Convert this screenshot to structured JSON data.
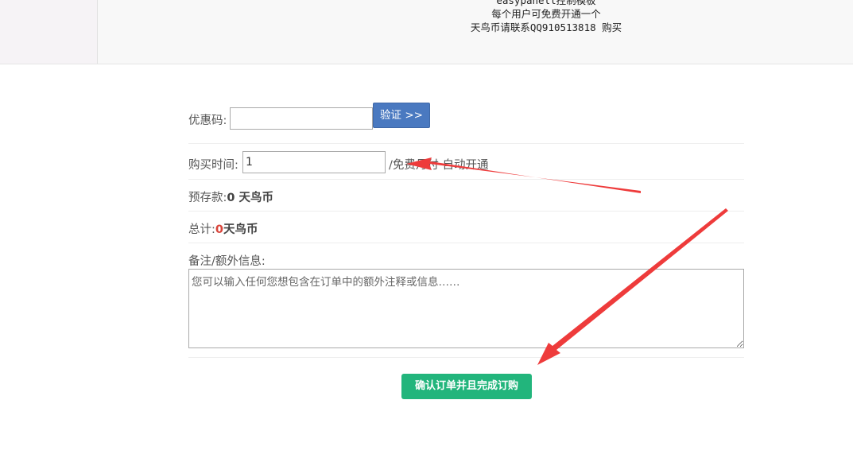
{
  "product": {
    "lines": [
      "easypanell控制模板",
      "每个用户可免费开通一个",
      "天鸟币请联系QQ910513818 购买"
    ]
  },
  "form": {
    "promo": {
      "label": "优惠码:",
      "value": "",
      "verify_label": "验证 >>"
    },
    "purchase_time": {
      "label": "购买时间:",
      "value": "1",
      "suffix": "/免费月付 自动开通"
    },
    "balance": {
      "label": "预存款:",
      "value": "0 天鸟币"
    },
    "total": {
      "label": "总计:",
      "amount": "0",
      "unit": "天鸟币"
    },
    "notes": {
      "label": "备注/额外信息:",
      "placeholder": "您可以输入任何您想包含在订单中的额外注释或信息……"
    },
    "confirm_label": "确认订单并且完成订购"
  },
  "colors": {
    "verify_button": "#4a79c0",
    "confirm_button": "#22b57c",
    "total_amount": "#d9443a",
    "annotation_arrow": "#ee3b3b"
  }
}
